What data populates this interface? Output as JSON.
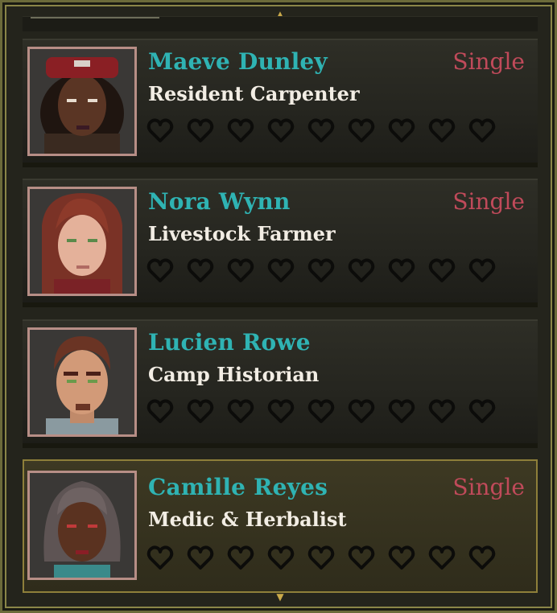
{
  "scroll": {
    "up_icon": "up-arrow-icon",
    "down_icon": "down-arrow-icon"
  },
  "villagers": [
    {
      "name": "Maeve Dunley",
      "role": "Resident Carpenter",
      "status": "Single",
      "hearts_filled": 0,
      "hearts_total": 9,
      "selected": false,
      "portrait": "portrait-maeve"
    },
    {
      "name": "Nora Wynn",
      "role": "Livestock Farmer",
      "status": "Single",
      "hearts_filled": 0,
      "hearts_total": 9,
      "selected": false,
      "portrait": "portrait-nora"
    },
    {
      "name": "Lucien Rowe",
      "role": "Camp Historian",
      "status": "",
      "hearts_filled": 0,
      "hearts_total": 9,
      "selected": false,
      "portrait": "portrait-lucien"
    },
    {
      "name": "Camille Reyes",
      "role": "Medic & Herbalist",
      "status": "Single",
      "hearts_filled": 0,
      "hearts_total": 9,
      "selected": true,
      "portrait": "portrait-camille"
    }
  ],
  "colors": {
    "name": "#2fb3b3",
    "status": "#c04a5a",
    "role": "#f2ede4",
    "heart_empty": "#0c0c0a",
    "selected_border": "#8e7f3a"
  }
}
